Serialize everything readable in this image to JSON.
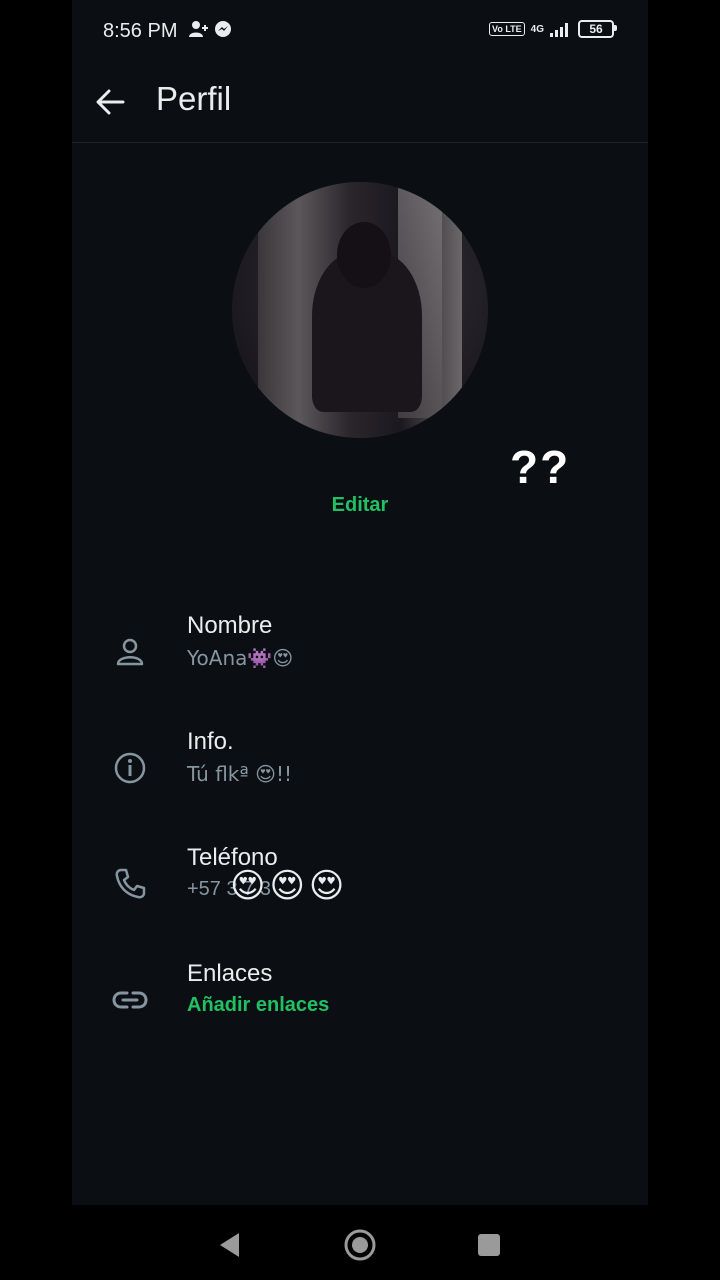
{
  "status_bar": {
    "time": "8:56 PM",
    "network": "4G",
    "volte": "Vo LTE",
    "battery": "56"
  },
  "app_bar": {
    "title": "Perfil"
  },
  "profile": {
    "edit_label": "Editar",
    "overlay_text": "??"
  },
  "rows": [
    {
      "icon": "person-icon",
      "title": "Nombre",
      "value": "YoAna👾😍"
    },
    {
      "icon": "info-icon",
      "title": "Info.",
      "value": "Tú flkª 😍!!"
    },
    {
      "icon": "phone-icon",
      "title": "Teléfono",
      "value": "+57 3 7 3",
      "value_overlay": "😍😍😍"
    },
    {
      "icon": "link-icon",
      "title": "Enlaces",
      "value": "Añadir enlaces"
    }
  ],
  "colors": {
    "accent": "#21c063",
    "background": "#0b0f13",
    "secondary_text": "#8696a0"
  }
}
